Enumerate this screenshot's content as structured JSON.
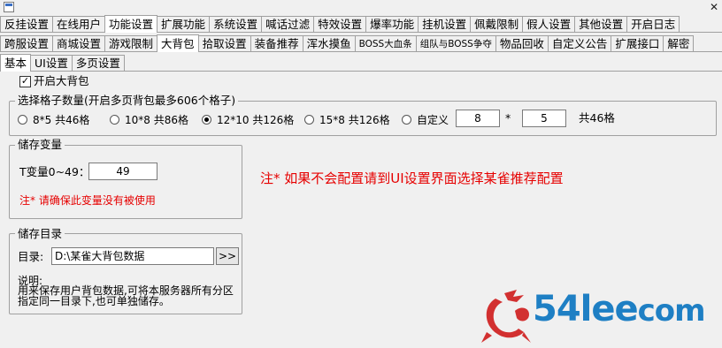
{
  "top_tabs_row1": [
    "反挂设置",
    "在线用户",
    "功能设置",
    "扩展功能",
    "系统设置",
    "喊话过滤",
    "特效设置",
    "爆率功能",
    "挂机设置",
    "佩戴限制",
    "假人设置",
    "其他设置",
    "开启日志"
  ],
  "top_tabs_row1_active": "功能设置",
  "top_tabs_row2": [
    "跨服设置",
    "商城设置",
    "游戏限制",
    "大背包",
    "拾取设置",
    "装备推荐",
    "浑水摸鱼",
    "BOSS大血条",
    "组队与BOSS争夺",
    "物品回收",
    "自定义公告",
    "扩展接口",
    "解密"
  ],
  "top_tabs_row2_active": "大背包",
  "sub_tabs": [
    "基本",
    "UI设置",
    "多页设置"
  ],
  "sub_tabs_active": "基本",
  "enable_bag": {
    "label": "开启大背包",
    "checked": true
  },
  "slot_group": {
    "legend": "选择格子数量(开启多页背包最多606个格子)",
    "options": [
      {
        "label": "8*5 共46格",
        "checked": false
      },
      {
        "label": "10*8 共86格",
        "checked": false
      },
      {
        "label": "12*10 共126格",
        "checked": true
      },
      {
        "label": "15*8 共126格",
        "checked": false
      }
    ],
    "custom": {
      "label": "自定义",
      "value_a": "8",
      "multiply": "*",
      "value_b": "5",
      "total": "共46格",
      "checked": false
    }
  },
  "var_group": {
    "legend": "储存变量",
    "label": "T变量0~49：",
    "value": "49",
    "warning": "注* 请确保此变量没有被使用"
  },
  "red_note": "注* 如果不会配置请到UI设置界面选择某雀推荐配置",
  "dir_group": {
    "legend": "储存目录",
    "label": "目录:",
    "path": "D:\\某雀大背包数据",
    "browse": ">>",
    "desc_title": "说明:",
    "desc_line1": "用来保存用户背包数据,可将本服务器所有分区",
    "desc_line2": "指定同一目录下,也可单独储存。"
  },
  "watermark": {
    "text": "54lee",
    "text_suffix": "com",
    "color": "#1e7fc4"
  }
}
